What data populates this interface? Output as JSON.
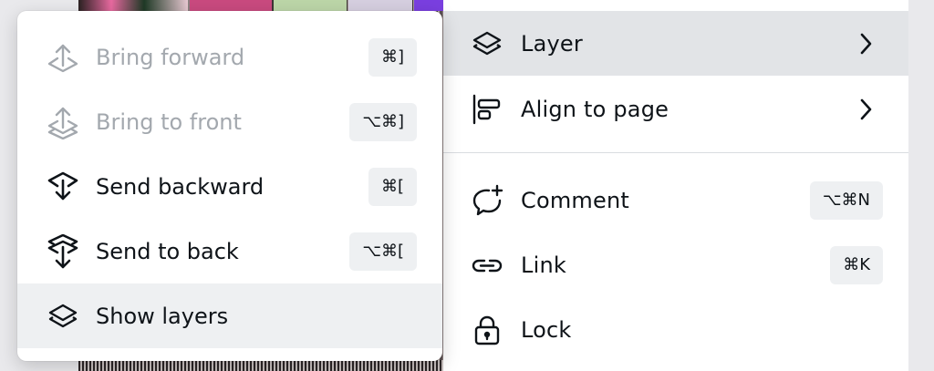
{
  "layer_submenu": {
    "items": [
      {
        "label": "Bring forward",
        "shortcut": "⌘]",
        "icon": "bring-forward-icon",
        "disabled": true
      },
      {
        "label": "Bring to front",
        "shortcut": "⌥⌘]",
        "icon": "bring-to-front-icon",
        "disabled": true
      },
      {
        "label": "Send backward",
        "shortcut": "⌘[",
        "icon": "send-backward-icon",
        "disabled": false
      },
      {
        "label": "Send to back",
        "shortcut": "⌥⌘[",
        "icon": "send-to-back-icon",
        "disabled": false
      },
      {
        "label": "Show layers",
        "shortcut": "",
        "icon": "layers-icon",
        "disabled": false,
        "highlighted": true
      }
    ]
  },
  "context_menu": {
    "items": [
      {
        "label": "Layer",
        "icon": "layers-icon",
        "submenu": true,
        "highlighted": true
      },
      {
        "label": "Align to page",
        "icon": "align-left-icon",
        "submenu": true
      },
      {
        "label": "Comment",
        "icon": "comment-add-icon",
        "shortcut": "⌥⌘N"
      },
      {
        "label": "Link",
        "icon": "link-icon",
        "shortcut": "⌘K"
      },
      {
        "label": "Lock",
        "icon": "lock-icon"
      }
    ]
  },
  "colors": {
    "text": "#0e1318",
    "disabled_text": "#a3a8ae",
    "hover_background": "#e2e4e7",
    "shortcut_background": "#eef0f2"
  }
}
